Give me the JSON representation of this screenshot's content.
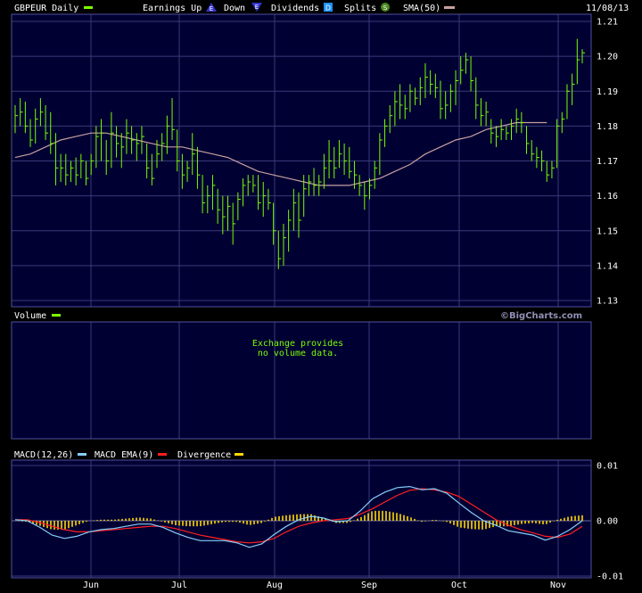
{
  "header": {
    "symbol_label": "GBPEUR Daily",
    "earnings_up_label": "Earnings Up",
    "down_label": "Down",
    "dividends_label": "Dividends",
    "splits_label": "Splits",
    "sma_label": "SMA(50)",
    "date": "11/08/13"
  },
  "volume_panel": {
    "label": "Volume",
    "note_line1": "Exchange provides",
    "note_line2": "no volume data.",
    "watermark": "©BigCharts.com"
  },
  "macd_panel": {
    "macd_label": "MACD(12,26)",
    "ema_label": "MACD EMA(9)",
    "divergence_label": "Divergence"
  },
  "colors": {
    "background": "#000000",
    "panel_bg": "#000033",
    "grid": "#3a3a7a",
    "price_bars": "#7CFC00",
    "sma": "#c8a0a0",
    "macd": "#87cefa",
    "ema": "#ff2020",
    "divergence": "#ffd700"
  },
  "chart_data": [
    {
      "type": "ohlc",
      "title": "GBPEUR Daily",
      "x_ticks": [
        "Jun",
        "Jul",
        "Aug",
        "Sep",
        "Oct",
        "Nov"
      ],
      "y_ticks": [
        "1.21",
        "1.20",
        "1.19",
        "1.18",
        "1.17",
        "1.16",
        "1.15",
        "1.14",
        "1.13"
      ],
      "ylim": [
        1.13,
        1.21
      ],
      "bars": [
        {
          "high": 1.186,
          "low": 1.178,
          "close": 1.183
        },
        {
          "high": 1.188,
          "low": 1.18,
          "close": 1.184
        },
        {
          "high": 1.187,
          "low": 1.178,
          "close": 1.18
        },
        {
          "high": 1.182,
          "low": 1.174,
          "close": 1.176
        },
        {
          "high": 1.185,
          "low": 1.175,
          "close": 1.182
        },
        {
          "high": 1.188,
          "low": 1.18,
          "close": 1.184
        },
        {
          "high": 1.186,
          "low": 1.176,
          "close": 1.178
        },
        {
          "high": 1.184,
          "low": 1.172,
          "close": 1.175
        },
        {
          "high": 1.178,
          "low": 1.163,
          "close": 1.168
        },
        {
          "high": 1.172,
          "low": 1.164,
          "close": 1.168
        },
        {
          "high": 1.172,
          "low": 1.163,
          "close": 1.166
        },
        {
          "high": 1.17,
          "low": 1.164,
          "close": 1.168
        },
        {
          "high": 1.171,
          "low": 1.163,
          "close": 1.166
        },
        {
          "high": 1.172,
          "low": 1.165,
          "close": 1.17
        },
        {
          "high": 1.17,
          "low": 1.163,
          "close": 1.165
        },
        {
          "high": 1.172,
          "low": 1.166,
          "close": 1.17
        },
        {
          "high": 1.18,
          "low": 1.168,
          "close": 1.177
        },
        {
          "high": 1.182,
          "low": 1.17,
          "close": 1.178
        },
        {
          "high": 1.176,
          "low": 1.166,
          "close": 1.17
        },
        {
          "high": 1.184,
          "low": 1.168,
          "close": 1.178
        },
        {
          "high": 1.18,
          "low": 1.171,
          "close": 1.175
        },
        {
          "high": 1.178,
          "low": 1.168,
          "close": 1.174
        },
        {
          "high": 1.182,
          "low": 1.172,
          "close": 1.178
        },
        {
          "high": 1.18,
          "low": 1.172,
          "close": 1.176
        },
        {
          "high": 1.178,
          "low": 1.17,
          "close": 1.175
        },
        {
          "high": 1.18,
          "low": 1.172,
          "close": 1.177
        },
        {
          "high": 1.175,
          "low": 1.165,
          "close": 1.168
        },
        {
          "high": 1.172,
          "low": 1.163,
          "close": 1.165
        },
        {
          "high": 1.176,
          "low": 1.168,
          "close": 1.172
        },
        {
          "high": 1.178,
          "low": 1.17,
          "close": 1.175
        },
        {
          "high": 1.183,
          "low": 1.172,
          "close": 1.18
        },
        {
          "high": 1.188,
          "low": 1.176,
          "close": 1.179
        },
        {
          "high": 1.179,
          "low": 1.167,
          "close": 1.17
        },
        {
          "high": 1.172,
          "low": 1.162,
          "close": 1.166
        },
        {
          "high": 1.17,
          "low": 1.164,
          "close": 1.168
        },
        {
          "high": 1.178,
          "low": 1.166,
          "close": 1.172
        },
        {
          "high": 1.174,
          "low": 1.162,
          "close": 1.166
        },
        {
          "high": 1.166,
          "low": 1.155,
          "close": 1.158
        },
        {
          "high": 1.163,
          "low": 1.155,
          "close": 1.16
        },
        {
          "high": 1.166,
          "low": 1.156,
          "close": 1.163
        },
        {
          "high": 1.162,
          "low": 1.152,
          "close": 1.156
        },
        {
          "high": 1.16,
          "low": 1.149,
          "close": 1.154
        },
        {
          "high": 1.16,
          "low": 1.15,
          "close": 1.157
        },
        {
          "high": 1.158,
          "low": 1.146,
          "close": 1.152
        },
        {
          "high": 1.161,
          "low": 1.153,
          "close": 1.159
        },
        {
          "high": 1.165,
          "low": 1.157,
          "close": 1.163
        },
        {
          "high": 1.166,
          "low": 1.16,
          "close": 1.164
        },
        {
          "high": 1.166,
          "low": 1.161,
          "close": 1.163
        },
        {
          "high": 1.166,
          "low": 1.156,
          "close": 1.158
        },
        {
          "high": 1.164,
          "low": 1.154,
          "close": 1.16
        },
        {
          "high": 1.162,
          "low": 1.156,
          "close": 1.158
        },
        {
          "high": 1.158,
          "low": 1.146,
          "close": 1.15
        },
        {
          "high": 1.15,
          "low": 1.139,
          "close": 1.142
        },
        {
          "high": 1.152,
          "low": 1.14,
          "close": 1.148
        },
        {
          "high": 1.156,
          "low": 1.144,
          "close": 1.153
        },
        {
          "high": 1.162,
          "low": 1.15,
          "close": 1.158
        },
        {
          "high": 1.161,
          "low": 1.148,
          "close": 1.153
        },
        {
          "high": 1.166,
          "low": 1.154,
          "close": 1.162
        },
        {
          "high": 1.166,
          "low": 1.16,
          "close": 1.164
        },
        {
          "high": 1.168,
          "low": 1.16,
          "close": 1.163
        },
        {
          "high": 1.166,
          "low": 1.16,
          "close": 1.164
        },
        {
          "high": 1.172,
          "low": 1.162,
          "close": 1.168
        },
        {
          "high": 1.176,
          "low": 1.165,
          "close": 1.17
        },
        {
          "high": 1.174,
          "low": 1.165,
          "close": 1.168
        },
        {
          "high": 1.176,
          "low": 1.168,
          "close": 1.172
        },
        {
          "high": 1.175,
          "low": 1.166,
          "close": 1.17
        },
        {
          "high": 1.174,
          "low": 1.165,
          "close": 1.167
        },
        {
          "high": 1.17,
          "low": 1.162,
          "close": 1.166
        },
        {
          "high": 1.166,
          "low": 1.16,
          "close": 1.163
        },
        {
          "high": 1.164,
          "low": 1.156,
          "close": 1.16
        },
        {
          "high": 1.165,
          "low": 1.159,
          "close": 1.163
        },
        {
          "high": 1.17,
          "low": 1.162,
          "close": 1.168
        },
        {
          "high": 1.178,
          "low": 1.166,
          "close": 1.176
        },
        {
          "high": 1.182,
          "low": 1.174,
          "close": 1.18
        },
        {
          "high": 1.186,
          "low": 1.178,
          "close": 1.183
        },
        {
          "high": 1.19,
          "low": 1.18,
          "close": 1.187
        },
        {
          "high": 1.192,
          "low": 1.182,
          "close": 1.186
        },
        {
          "high": 1.189,
          "low": 1.182,
          "close": 1.185
        },
        {
          "high": 1.192,
          "low": 1.184,
          "close": 1.19
        },
        {
          "high": 1.191,
          "low": 1.186,
          "close": 1.188
        },
        {
          "high": 1.194,
          "low": 1.186,
          "close": 1.191
        },
        {
          "high": 1.198,
          "low": 1.188,
          "close": 1.194
        },
        {
          "high": 1.196,
          "low": 1.189,
          "close": 1.192
        },
        {
          "high": 1.195,
          "low": 1.188,
          "close": 1.191
        },
        {
          "high": 1.193,
          "low": 1.182,
          "close": 1.185
        },
        {
          "high": 1.19,
          "low": 1.182,
          "close": 1.186
        },
        {
          "high": 1.192,
          "low": 1.184,
          "close": 1.19
        },
        {
          "high": 1.196,
          "low": 1.186,
          "close": 1.193
        },
        {
          "high": 1.2,
          "low": 1.192,
          "close": 1.196
        },
        {
          "high": 1.201,
          "low": 1.195,
          "close": 1.199
        },
        {
          "high": 1.2,
          "low": 1.19,
          "close": 1.193
        },
        {
          "high": 1.194,
          "low": 1.182,
          "close": 1.186
        },
        {
          "high": 1.188,
          "low": 1.18,
          "close": 1.183
        },
        {
          "high": 1.187,
          "low": 1.18,
          "close": 1.184
        },
        {
          "high": 1.182,
          "low": 1.175,
          "close": 1.178
        },
        {
          "high": 1.18,
          "low": 1.174,
          "close": 1.177
        },
        {
          "high": 1.182,
          "low": 1.176,
          "close": 1.179
        },
        {
          "high": 1.18,
          "low": 1.176,
          "close": 1.178
        },
        {
          "high": 1.182,
          "low": 1.176,
          "close": 1.18
        },
        {
          "high": 1.185,
          "low": 1.178,
          "close": 1.182
        },
        {
          "high": 1.184,
          "low": 1.178,
          "close": 1.181
        },
        {
          "high": 1.18,
          "low": 1.172,
          "close": 1.175
        },
        {
          "high": 1.176,
          "low": 1.17,
          "close": 1.172
        },
        {
          "high": 1.174,
          "low": 1.168,
          "close": 1.171
        },
        {
          "high": 1.173,
          "low": 1.167,
          "close": 1.17
        },
        {
          "high": 1.17,
          "low": 1.164,
          "close": 1.166
        },
        {
          "high": 1.17,
          "low": 1.165,
          "close": 1.168
        },
        {
          "high": 1.182,
          "low": 1.168,
          "close": 1.18
        },
        {
          "high": 1.184,
          "low": 1.178,
          "close": 1.182
        },
        {
          "high": 1.192,
          "low": 1.182,
          "close": 1.19
        },
        {
          "high": 1.195,
          "low": 1.186,
          "close": 1.192
        },
        {
          "high": 1.205,
          "low": 1.192,
          "close": 1.199
        },
        {
          "high": 1.202,
          "low": 1.198,
          "close": 1.201
        }
      ],
      "sma50": [
        1.171,
        1.172,
        1.174,
        1.176,
        1.177,
        1.178,
        1.178,
        1.177,
        1.176,
        1.175,
        1.174,
        1.174,
        1.173,
        1.172,
        1.171,
        1.169,
        1.167,
        1.166,
        1.165,
        1.164,
        1.163,
        1.163,
        1.163,
        1.164,
        1.165,
        1.167,
        1.169,
        1.172,
        1.174,
        1.176,
        1.177,
        1.179,
        1.18,
        1.181,
        1.181,
        1.181
      ],
      "sma50_step": 3
    },
    {
      "type": "bar",
      "title": "Volume",
      "note": "Exchange provides no volume data."
    },
    {
      "type": "line",
      "title": "MACD(12,26)",
      "y_ticks": [
        "0.01",
        "0.00",
        "-0.01"
      ],
      "ylim": [
        -0.01,
        0.01
      ],
      "series": [
        {
          "name": "MACD(12,26)",
          "values": [
            0.0002,
            0.0,
            -0.0012,
            -0.0026,
            -0.0032,
            -0.0028,
            -0.002,
            -0.0016,
            -0.0014,
            -0.001,
            -0.0006,
            -0.0006,
            -0.0012,
            -0.0022,
            -0.003,
            -0.0036,
            -0.0036,
            -0.0036,
            -0.004,
            -0.0048,
            -0.0042,
            -0.0025,
            -0.001,
            0.0002,
            0.0008,
            0.0005,
            -0.0002,
            0.0,
            0.0018,
            0.004,
            0.0052,
            0.006,
            0.0062,
            0.0056,
            0.0058,
            0.005,
            0.0032,
            0.0015,
            0.0,
            -0.0008,
            -0.0018,
            -0.0022,
            -0.0026,
            -0.0035,
            -0.0028,
            -0.0016,
            0.0
          ]
        },
        {
          "name": "MACD EMA(9)",
          "values": [
            0.0002,
            0.0002,
            -0.0003,
            -0.001,
            -0.0016,
            -0.002,
            -0.002,
            -0.0018,
            -0.0016,
            -0.0014,
            -0.0012,
            -0.001,
            -0.001,
            -0.0014,
            -0.002,
            -0.0026,
            -0.003,
            -0.0034,
            -0.0038,
            -0.004,
            -0.0038,
            -0.0032,
            -0.002,
            -0.001,
            -0.0004,
            0.0,
            0.0002,
            0.0004,
            0.0012,
            0.0022,
            0.0034,
            0.0046,
            0.0055,
            0.0058,
            0.0056,
            0.0052,
            0.0044,
            0.003,
            0.0016,
            0.0002,
            -0.0008,
            -0.0016,
            -0.0022,
            -0.0028,
            -0.003,
            -0.0024,
            -0.001
          ]
        },
        {
          "name": "Divergence",
          "values": [
            0.0,
            -0.0002,
            -0.0009,
            -0.0016,
            -0.0016,
            -0.0008,
            0.0,
            0.0002,
            0.0002,
            0.0004,
            0.0006,
            0.0004,
            -0.0002,
            -0.0008,
            -0.001,
            -0.001,
            -0.0006,
            -0.0002,
            -0.0002,
            -0.0008,
            -0.0004,
            0.0007,
            0.001,
            0.0012,
            0.0012,
            0.0005,
            -0.0004,
            -0.0004,
            0.0006,
            0.0018,
            0.0018,
            0.0014,
            0.0007,
            -0.0002,
            0.0002,
            -0.0002,
            -0.0012,
            -0.0015,
            -0.0016,
            -0.001,
            -0.001,
            -0.0006,
            -0.0004,
            -0.0007,
            0.0002,
            0.0008,
            0.001
          ]
        }
      ]
    }
  ]
}
